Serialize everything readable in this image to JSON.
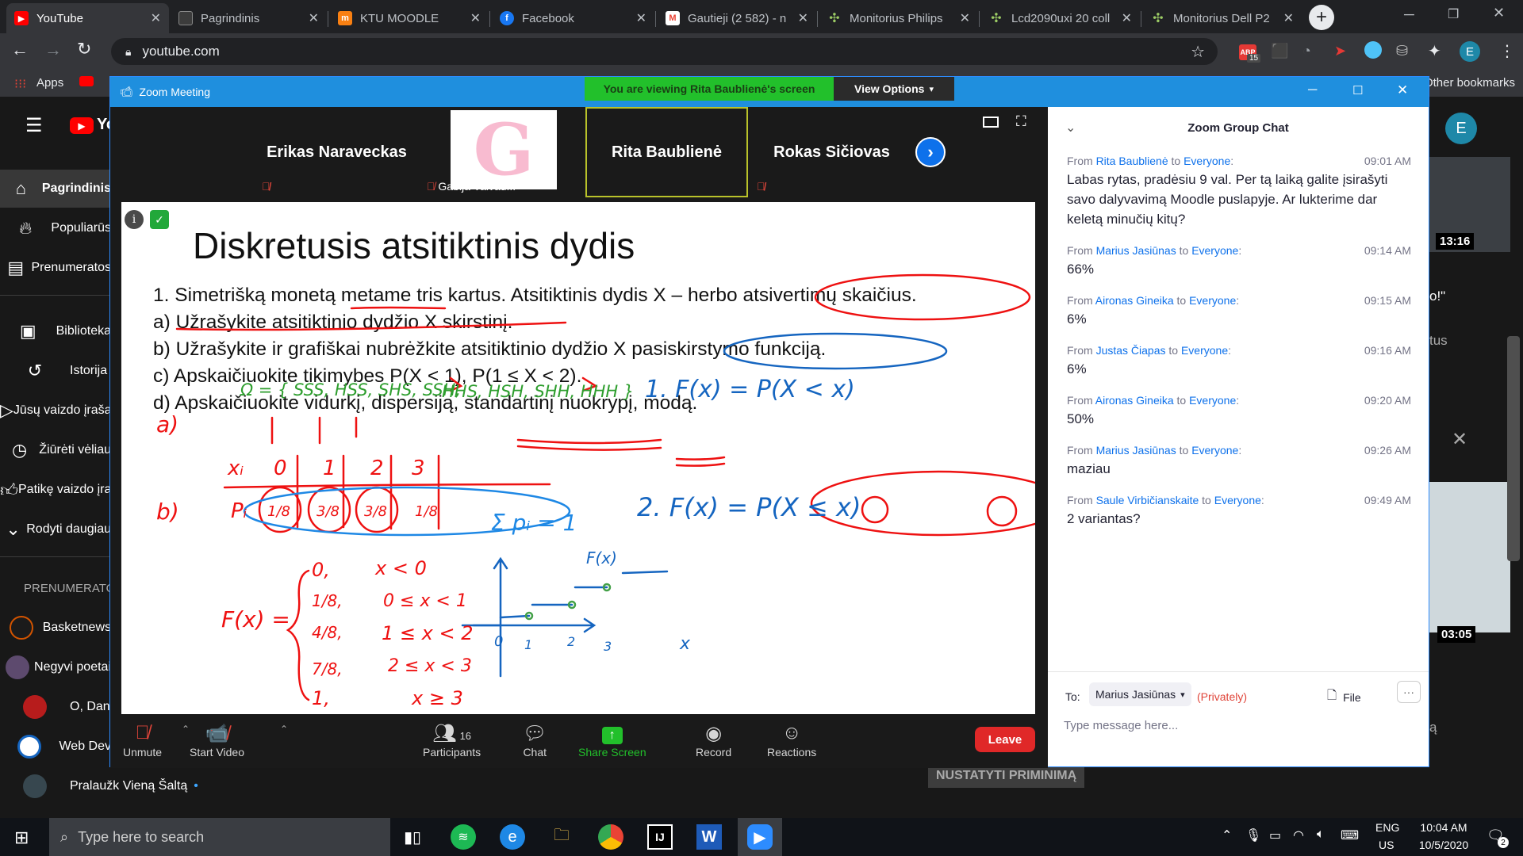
{
  "browser": {
    "tabs": [
      {
        "title": "YouTube",
        "fav_text": "▶",
        "fav_color": "#ff0000",
        "active": true
      },
      {
        "title": "Pagrindinis",
        "fav_text": "",
        "fav_color": "#3c3c3c"
      },
      {
        "title": "KTU MOODLE",
        "fav_text": "m",
        "fav_color": "#f98012"
      },
      {
        "title": "Facebook",
        "fav_text": "f",
        "fav_color": "#1877f2"
      },
      {
        "title": "Gautieji (2 582) - n",
        "fav_text": "M",
        "fav_color": "#ea4335"
      },
      {
        "title": "Monitorius Philips",
        "fav_text": "✣",
        "fav_color": "#7cb342"
      },
      {
        "title": "Lcd2090uxi 20 coll",
        "fav_text": "✣",
        "fav_color": "#7cb342"
      },
      {
        "title": "Monitorius Dell P2",
        "fav_text": "✣",
        "fav_color": "#7cb342"
      }
    ],
    "new_tab": "+",
    "address": "youtube.com",
    "bookmarks": {
      "apps": "Apps",
      "other": "Other bookmarks"
    },
    "profile_letter": "E",
    "ext_badge": "15"
  },
  "youtube": {
    "logo": "YouTube",
    "sidebar": [
      {
        "label": "Pagrindinis",
        "icon": "home-icon"
      },
      {
        "label": "Populiarūs",
        "icon": "fire-icon"
      },
      {
        "label": "Prenumeratos",
        "icon": "subscriptions-icon"
      },
      {
        "label": "Biblioteka",
        "icon": "library-icon"
      },
      {
        "label": "Istorija",
        "icon": "history-icon"
      },
      {
        "label": "Jūsų vaizdo įrašai",
        "icon": "my-videos-icon"
      },
      {
        "label": "Žiūrėti vėliau",
        "icon": "clock-icon"
      },
      {
        "label": "Patikę vaizdo įrašai",
        "icon": "thumbs-up-icon"
      },
      {
        "label": "Rodyti daugiau",
        "icon": "chevron-down-icon"
      }
    ],
    "subscriptions_heading": "PRENUMERATOS",
    "subscriptions": [
      "Basketnews",
      "Negyvi poetai",
      "O, Dan",
      "Web Dev",
      "Pralaužk Vieną Šaltą"
    ],
    "avatar": "E",
    "right_durations": [
      "13:16",
      "03:05"
    ],
    "right_texts": [
      "o!\"",
      "tus",
      "ą"
    ],
    "reminder_button": "NUSTATYTI PRIMINIMĄ"
  },
  "zoom": {
    "window_title": "Zoom Meeting",
    "banner": "You are viewing Rita Baublienė's screen",
    "view_options": "View Options",
    "participants": [
      {
        "name": "Erikas Naraveckas",
        "muted": true
      },
      {
        "name": "Gabija Vaivad...",
        "muted": true,
        "avatar_letter": "G"
      },
      {
        "name": "Rita Baublienė",
        "muted": false
      },
      {
        "name": "Rokas Sičiovas",
        "muted": true
      }
    ],
    "controls": {
      "unmute": "Unmute",
      "start_video": "Start Video",
      "participants": "Participants",
      "participants_count": "16",
      "chat": "Chat",
      "share_screen": "Share Screen",
      "record": "Record",
      "reactions": "Reactions",
      "leave": "Leave"
    },
    "slide": {
      "title": "Diskretusis atsitiktinis dydis",
      "lines": [
        "1.  Simetrišką monetą metame tris kartus. Atsitiktinis dydis X – herbo atsivertimų skaičius.",
        "a) Užrašykite atsitiktinio dydžio X skirstinį.",
        "b) Užrašykite ir grafiškai nubrėžkite atsitiktinio dydžio X pasiskirstymo funkciją.",
        "c) Apskaičiuokite tikimybes P(X < 1), P(1 ≤ X < 2).",
        "d) Apskaičiuokite vidurkį, dispersiją, standartinį nuokrypį, modą."
      ],
      "hw_omega": "Ω = { SSS, HSS, SHS, SSH,",
      "hw_omega2": "HHS, HSH, SHH, HHH }",
      "hw_a": "a)",
      "hw_b": "b)",
      "hw_xi": "xᵢ",
      "hw_pi": "Pᵢ",
      "hw_x_vals": [
        "0",
        "1",
        "2",
        "3"
      ],
      "hw_p_vals": [
        "1/8",
        "3/8",
        "3/8",
        "1/8"
      ],
      "hw_sum": "Σ pᵢ = 1",
      "hw_F": "F(x) =",
      "hw_cases": [
        "0,",
        "1/8,",
        "4/8,",
        "7/8,",
        "1,"
      ],
      "hw_conds": [
        "x < 0",
        "0 ≤ x < 1",
        "1 ≤ x < 2",
        "2 ≤ x < 3",
        "x ≥ 3"
      ],
      "hw_def1": "1.  F(x) = P(X < x)",
      "hw_def2": "2.  F(x) = P(X ≤ x)",
      "hw_graph_label": "F(x)",
      "hw_axis_x": "x",
      "hw_ticks": [
        "0",
        "1",
        "2",
        "3"
      ]
    },
    "chat": {
      "title": "Zoom Group Chat",
      "messages": [
        {
          "from": "Rita Baublienė",
          "to": "Everyone",
          "time": "09:01 AM",
          "text": "Labas rytas, pradėsiu 9 val. Per tą laiką galite įsirašyti savo dalyvavimą Moodle puslapyje. Ar lukterime dar keletą minučių kitų?"
        },
        {
          "from": "Marius Jasiūnas",
          "to": "Everyone",
          "time": "09:14 AM",
          "text": "66%"
        },
        {
          "from": "Aironas Gineika",
          "to": "Everyone",
          "time": "09:15 AM",
          "text": "6%"
        },
        {
          "from": "Justas Čiapas",
          "to": "Everyone",
          "time": "09:16 AM",
          "text": "6%"
        },
        {
          "from": "Aironas Gineika",
          "to": "Everyone",
          "time": "09:20 AM",
          "text": "50%"
        },
        {
          "from": "Marius Jasiūnas",
          "to": "Everyone",
          "time": "09:26 AM",
          "text": "maziau"
        },
        {
          "from": "Saule Virbičianskaite",
          "to": "Everyone",
          "time": "09:49 AM",
          "text": "2 variantas?"
        }
      ],
      "from_word": "From",
      "to_word": "to",
      "to_label": "To:",
      "recipient": "Marius Jasiūnas",
      "privately": "(Privately)",
      "file": "File",
      "more": "···",
      "placeholder": "Type message here..."
    }
  },
  "taskbar": {
    "search_placeholder": "Type here to search",
    "lang1": "ENG",
    "lang2": "US",
    "time": "10:04 AM",
    "date": "10/5/2020",
    "notif_count": "2"
  }
}
